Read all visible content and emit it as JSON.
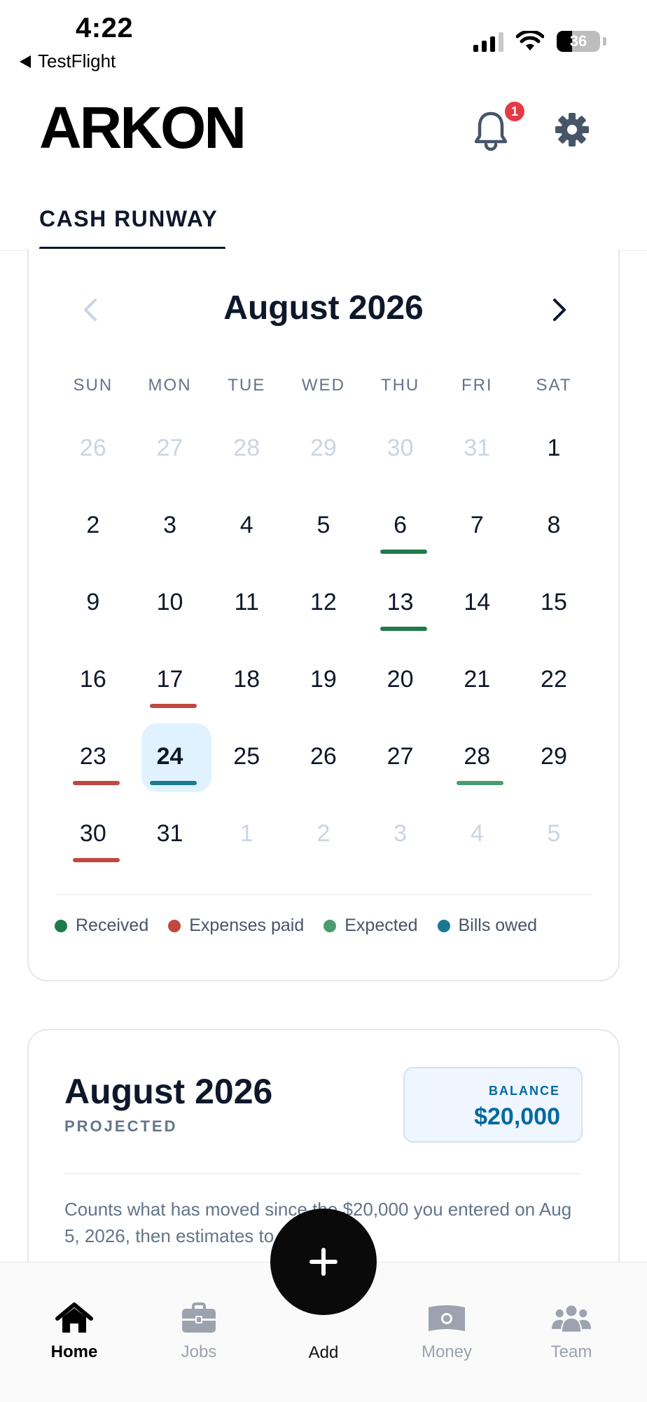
{
  "status_bar": {
    "time": "4:22",
    "back_app": "TestFlight",
    "battery": "36"
  },
  "header": {
    "logo": "ARKON",
    "notification_count": "1"
  },
  "tabs": [
    {
      "label": "CASH RUNWAY",
      "active": true
    }
  ],
  "calendar": {
    "month_label": "August 2026",
    "weekdays": [
      "SUN",
      "MON",
      "TUE",
      "WED",
      "THU",
      "FRI",
      "SAT"
    ],
    "weeks": [
      [
        {
          "d": "26",
          "muted": true
        },
        {
          "d": "27",
          "muted": true
        },
        {
          "d": "28",
          "muted": true
        },
        {
          "d": "29",
          "muted": true
        },
        {
          "d": "30",
          "muted": true
        },
        {
          "d": "31",
          "muted": true
        },
        {
          "d": "1"
        }
      ],
      [
        {
          "d": "2"
        },
        {
          "d": "3"
        },
        {
          "d": "4"
        },
        {
          "d": "5"
        },
        {
          "d": "6",
          "marker": "received"
        },
        {
          "d": "7"
        },
        {
          "d": "8"
        }
      ],
      [
        {
          "d": "9"
        },
        {
          "d": "10"
        },
        {
          "d": "11"
        },
        {
          "d": "12"
        },
        {
          "d": "13",
          "marker": "received"
        },
        {
          "d": "14"
        },
        {
          "d": "15"
        }
      ],
      [
        {
          "d": "16"
        },
        {
          "d": "17",
          "marker": "expenses"
        },
        {
          "d": "18"
        },
        {
          "d": "19"
        },
        {
          "d": "20"
        },
        {
          "d": "21"
        },
        {
          "d": "22"
        }
      ],
      [
        {
          "d": "23",
          "marker": "expenses"
        },
        {
          "d": "24",
          "today": true,
          "marker": "bills"
        },
        {
          "d": "25"
        },
        {
          "d": "26"
        },
        {
          "d": "27"
        },
        {
          "d": "28",
          "marker": "expected"
        },
        {
          "d": "29"
        }
      ],
      [
        {
          "d": "30",
          "marker": "expenses"
        },
        {
          "d": "31"
        },
        {
          "d": "1",
          "muted": true
        },
        {
          "d": "2",
          "muted": true
        },
        {
          "d": "3",
          "muted": true
        },
        {
          "d": "4",
          "muted": true
        },
        {
          "d": "5",
          "muted": true
        }
      ]
    ],
    "legend": [
      {
        "key": "received",
        "label": "Received",
        "color": "#1f7a4a"
      },
      {
        "key": "expenses",
        "label": "Expenses paid",
        "color": "#c0483f"
      },
      {
        "key": "expected",
        "label": "Expected",
        "color": "#4a9b6e"
      },
      {
        "key": "bills",
        "label": "Bills owed",
        "color": "#1a7891"
      }
    ]
  },
  "projection": {
    "title": "August 2026",
    "subtitle": "PROJECTED",
    "balance_label": "BALANCE",
    "balance_value": "$20,000",
    "note": "Counts what has moved since the $20,000 you entered on Aug 5, 2026, then estimates to today."
  },
  "bottom_nav": {
    "items": [
      {
        "key": "home",
        "label": "Home",
        "active": true
      },
      {
        "key": "jobs",
        "label": "Jobs"
      },
      {
        "key": "money",
        "label": "Money"
      },
      {
        "key": "team",
        "label": "Team"
      }
    ],
    "add_label": "Add"
  }
}
